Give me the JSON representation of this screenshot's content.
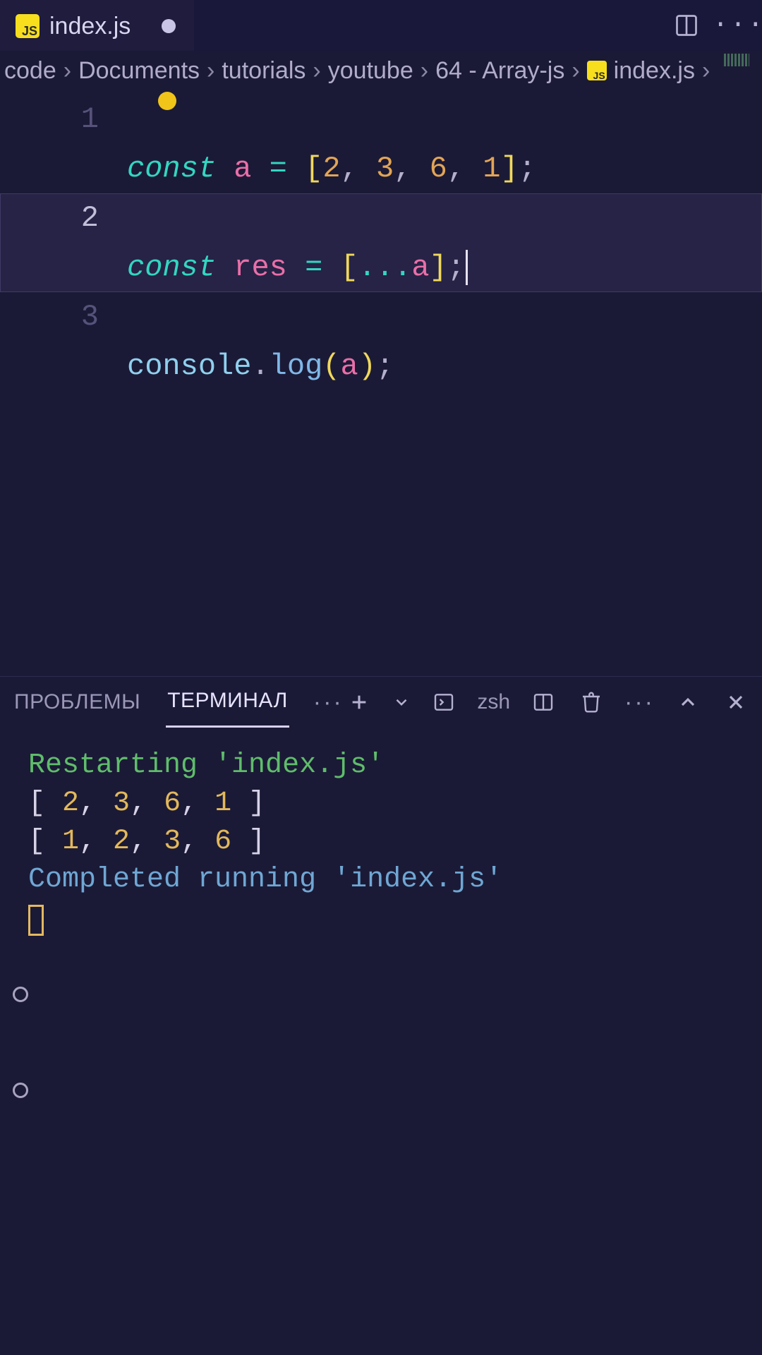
{
  "tab": {
    "title": "index.js",
    "dirty": true
  },
  "breadcrumbs": {
    "segments": [
      "code",
      "Documents",
      "tutorials",
      "youtube",
      "64 - Array-js"
    ],
    "file": "index.js"
  },
  "code": {
    "lines": [
      {
        "n": "1"
      },
      {
        "n": "2"
      },
      {
        "n": "3"
      }
    ],
    "current_line": 2,
    "tok": {
      "const": "const",
      "a": "a",
      "res": "res",
      "eq": " = ",
      "lbr": "[",
      "rbr": "]",
      "lp": "(",
      "rp": ")",
      "semi": ";",
      "comma": ", ",
      "n2": "2",
      "n3": "3",
      "n6": "6",
      "n1": "1",
      "spread": "...",
      "console": "console",
      "dot": ".",
      "log": "log"
    }
  },
  "panel": {
    "tabs": {
      "problems": "ПРОБЛЕМЫ",
      "terminal": "ТЕРМИНАЛ"
    },
    "shell": "zsh"
  },
  "terminal": {
    "restart_prefix": "Restarting ",
    "restart_file": "'index.js'",
    "array1": {
      "open": "[ ",
      "v1": "2",
      "v2": "3",
      "v3": "6",
      "v4": "1",
      "close": " ]",
      "sep": ", "
    },
    "array2": {
      "open": "[ ",
      "v1": "1",
      "v2": "2",
      "v3": "3",
      "v4": "6",
      "close": " ]",
      "sep": ", "
    },
    "done_prefix": "Completed running ",
    "done_file": "'index.js'"
  }
}
